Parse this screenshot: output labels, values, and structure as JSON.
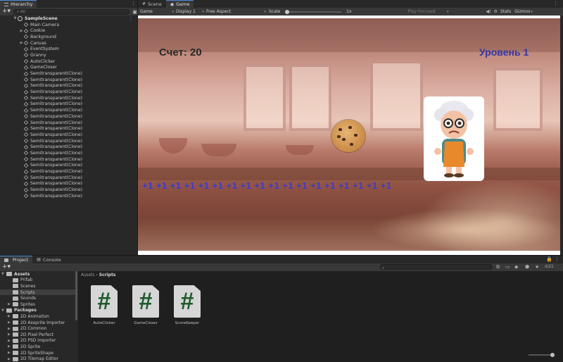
{
  "hierarchy": {
    "tab": "Hierarchy",
    "search_placeholder": "All",
    "scene": "SampleScene",
    "items": [
      {
        "label": "Main Camera",
        "arrow": ""
      },
      {
        "label": "Cookie",
        "arrow": "▶"
      },
      {
        "label": "Background",
        "arrow": ""
      },
      {
        "label": "Canvas",
        "arrow": "▶"
      },
      {
        "label": "EventSystem",
        "arrow": ""
      },
      {
        "label": "Granny",
        "arrow": ""
      },
      {
        "label": "AutoClicker",
        "arrow": ""
      },
      {
        "label": "GameCloser",
        "arrow": ""
      },
      {
        "label": "Semitransparent(Clone)",
        "arrow": ""
      },
      {
        "label": "Semitransparent(Clone)",
        "arrow": ""
      },
      {
        "label": "Semitransparent(Clone)",
        "arrow": ""
      },
      {
        "label": "Semitransparent(Clone)",
        "arrow": ""
      },
      {
        "label": "Semitransparent(Clone)",
        "arrow": ""
      },
      {
        "label": "Semitransparent(Clone)",
        "arrow": ""
      },
      {
        "label": "Semitransparent(Clone)",
        "arrow": ""
      },
      {
        "label": "Semitransparent(Clone)",
        "arrow": ""
      },
      {
        "label": "Semitransparent(Clone)",
        "arrow": ""
      },
      {
        "label": "Semitransparent(Clone)",
        "arrow": ""
      },
      {
        "label": "Semitransparent(Clone)",
        "arrow": ""
      },
      {
        "label": "Semitransparent(Clone)",
        "arrow": ""
      },
      {
        "label": "Semitransparent(Clone)",
        "arrow": ""
      },
      {
        "label": "Semitransparent(Clone)",
        "arrow": ""
      },
      {
        "label": "Semitransparent(Clone)",
        "arrow": ""
      },
      {
        "label": "Semitransparent(Clone)",
        "arrow": ""
      },
      {
        "label": "Semitransparent(Clone)",
        "arrow": ""
      },
      {
        "label": "Semitransparent(Clone)",
        "arrow": ""
      },
      {
        "label": "Semitransparent(Clone)",
        "arrow": ""
      },
      {
        "label": "Semitransparent(Clone)",
        "arrow": ""
      },
      {
        "label": "Semitransparent(Clone)",
        "arrow": ""
      }
    ]
  },
  "view_tabs": {
    "scene": "Scene",
    "game": "Game"
  },
  "game_toolbar": {
    "mode": "Game",
    "display": "Display 1",
    "aspect": "Free Aspect",
    "scale_label": "Scale",
    "scale_value": "1x",
    "play_mode": "Play Focused",
    "stats": "Stats",
    "gizmos": "Gizmos"
  },
  "game": {
    "score": "Счет: 20",
    "level": "Уровень 1",
    "ones": "+1 +1 +1 +1 +1 +1 +1 +1 +1 +1 +1 +1 +1 +1 +1 +1 +1 +1"
  },
  "project": {
    "tabs": {
      "project": "Project",
      "console": "Console"
    },
    "badge": "21",
    "tree": [
      {
        "label": "Assets",
        "arrow": "▼",
        "indent": 0,
        "bold": true
      },
      {
        "label": "Prifab",
        "arrow": "",
        "indent": 1
      },
      {
        "label": "Scenes",
        "arrow": "",
        "indent": 1
      },
      {
        "label": "Scripts",
        "arrow": "",
        "indent": 1,
        "selected": true
      },
      {
        "label": "Sounds",
        "arrow": "",
        "indent": 1
      },
      {
        "label": "Sprites",
        "arrow": "▶",
        "indent": 1
      },
      {
        "label": "Packages",
        "arrow": "▼",
        "indent": 0,
        "bold": true
      },
      {
        "label": "2D Animation",
        "arrow": "▶",
        "indent": 1
      },
      {
        "label": "2D Aseprite Importer",
        "arrow": "▶",
        "indent": 1
      },
      {
        "label": "2D Common",
        "arrow": "▶",
        "indent": 1
      },
      {
        "label": "2D Pixel Perfect",
        "arrow": "▶",
        "indent": 1
      },
      {
        "label": "2D PSD Importer",
        "arrow": "▶",
        "indent": 1
      },
      {
        "label": "2D Sprite",
        "arrow": "▶",
        "indent": 1
      },
      {
        "label": "2D SpriteShape",
        "arrow": "▶",
        "indent": 1
      },
      {
        "label": "2D Tilemap Editor",
        "arrow": "▶",
        "indent": 1
      }
    ],
    "breadcrumb_root": "Assets",
    "breadcrumb_current": "Scripts",
    "assets": [
      {
        "name": "AutoClicker",
        "glyph": "#"
      },
      {
        "name": "GameCloser",
        "glyph": "#"
      },
      {
        "name": "ScoreKeeper",
        "glyph": "#"
      }
    ]
  }
}
